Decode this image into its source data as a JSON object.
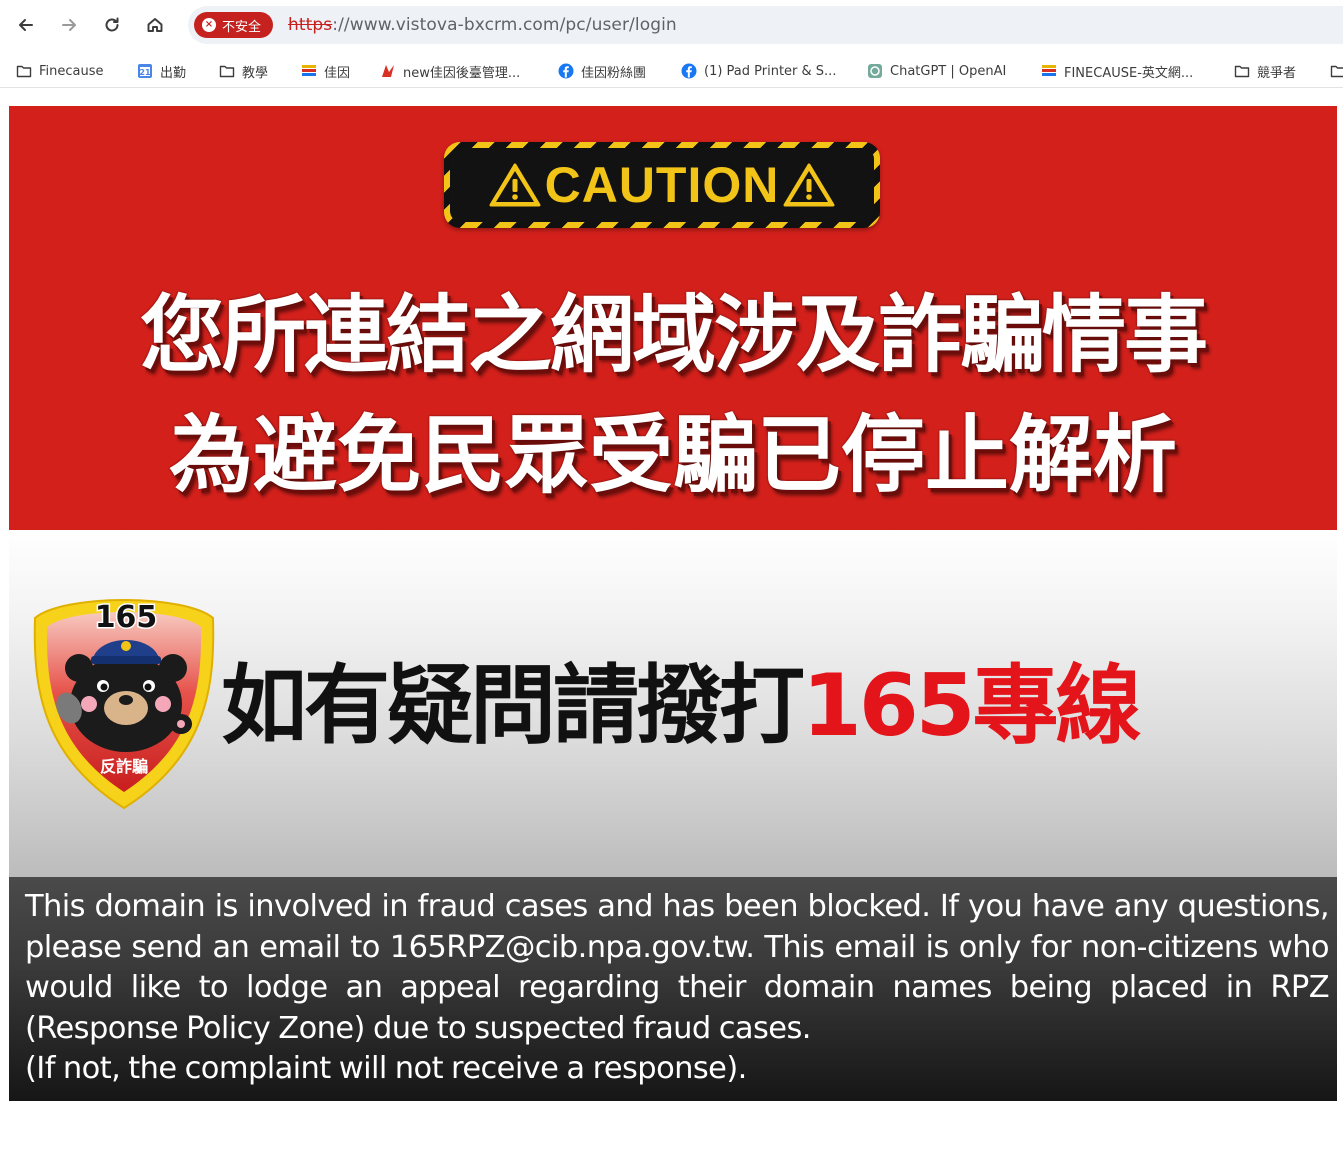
{
  "browser": {
    "security_label": "不安全",
    "url_scheme": "https",
    "url_rest": "://www.vistova-bxcrm.com/pc/user/login"
  },
  "bookmarks": [
    {
      "label": "Finecause",
      "icon": "folder-icon"
    },
    {
      "label": "出勤",
      "icon": "calendar-icon"
    },
    {
      "label": "教學",
      "icon": "folder-icon"
    },
    {
      "label": "佳因",
      "icon": "flag-icon"
    },
    {
      "label": "new佳因後臺管理...",
      "icon": "app-icon"
    },
    {
      "label": "佳因粉絲團",
      "icon": "facebook-icon"
    },
    {
      "label": "(1) Pad Printer & S...",
      "icon": "facebook-icon"
    },
    {
      "label": "ChatGPT | OpenAI",
      "icon": "chatgpt-icon"
    },
    {
      "label": "FINECAUSE-英文網...",
      "icon": "flag-icon"
    },
    {
      "label": "競爭者",
      "icon": "folder-icon"
    }
  ],
  "warning": {
    "caution_label": "CAUTION",
    "line1": "您所連結之網域涉及詐騙情事",
    "line2": "為避免民眾受騙已停止解析"
  },
  "badge": {
    "number": "165",
    "caption": "反詐騙"
  },
  "hotline": {
    "text_black": "如有疑問請撥打",
    "text_red": "165專線"
  },
  "notice": {
    "paragraph": "This domain is involved in fraud cases and has been blocked. If you have any questions, please send an email to 165RPZ@cib.npa.gov.tw. This email is only for non-citizens who would like to lodge an appeal regarding their domain names being placed in RPZ (Response Policy Zone) due to suspected fraud cases.",
    "footnote": "(If not, the complaint will not receive a response)."
  },
  "colors": {
    "warning_red": "#d3201b",
    "caution_yellow": "#f2c418",
    "hotline_red": "#e4141b",
    "insecure_red": "#c5221f"
  }
}
